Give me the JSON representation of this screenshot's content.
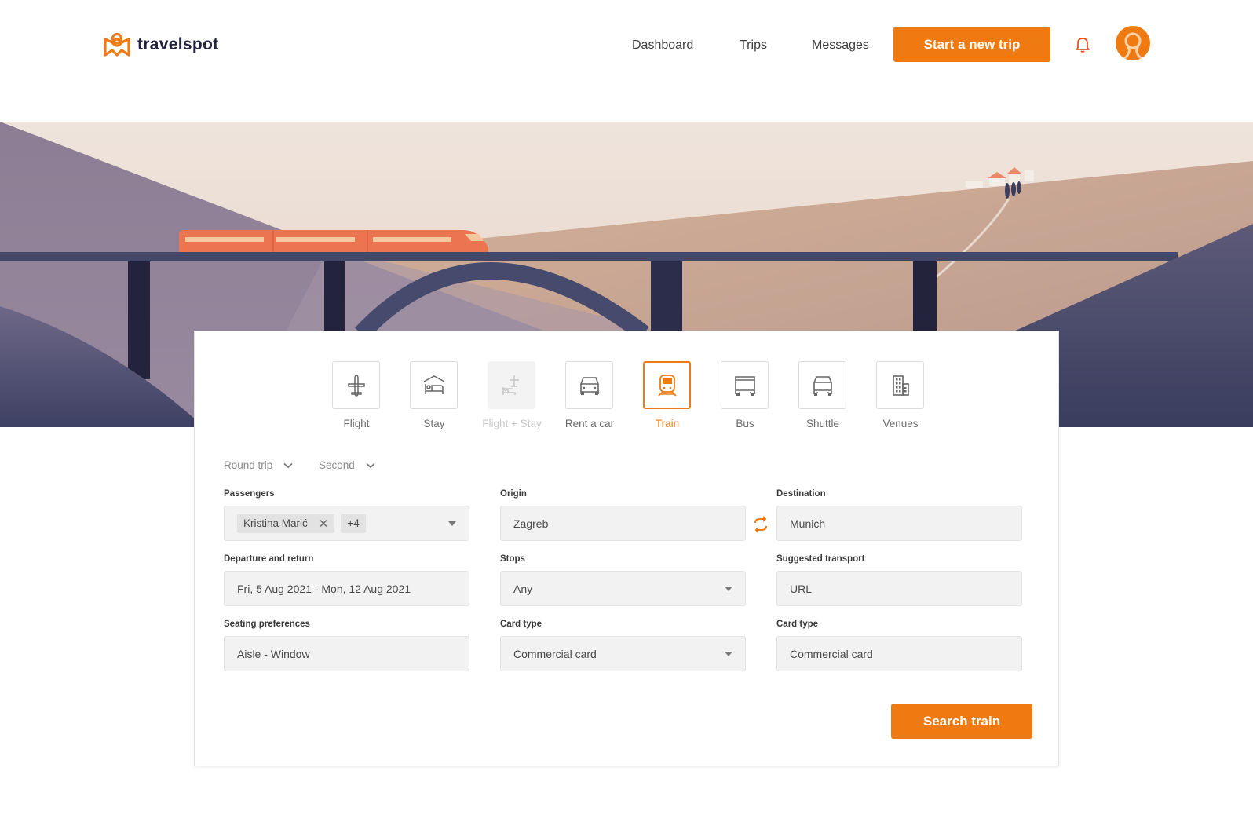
{
  "brand": {
    "name": "travelspot",
    "accent": "#f07a12",
    "text_color": "#23233d"
  },
  "nav": {
    "items": [
      {
        "label": "Dashboard"
      },
      {
        "label": "Trips"
      },
      {
        "label": "Messages"
      }
    ],
    "cta_label": "Start a new trip",
    "bell_icon": "bell-icon",
    "avatar_icon": "user-avatar"
  },
  "hero": {
    "illustration": "train-on-bridge-landscape"
  },
  "modes": {
    "selected": "Train",
    "items": [
      {
        "label": "Flight",
        "icon": "airplane-icon",
        "state": "default"
      },
      {
        "label": "Stay",
        "icon": "bed-icon",
        "state": "default"
      },
      {
        "label": "Flight + Stay",
        "icon": "flight-stay-icon",
        "state": "disabled"
      },
      {
        "label": "Rent a car",
        "icon": "car-icon",
        "state": "default"
      },
      {
        "label": "Train",
        "icon": "train-icon",
        "state": "active"
      },
      {
        "label": "Bus",
        "icon": "bus-icon",
        "state": "default"
      },
      {
        "label": "Shuttle",
        "icon": "shuttle-icon",
        "state": "default"
      },
      {
        "label": "Venues",
        "icon": "building-icon",
        "state": "default"
      }
    ]
  },
  "options": {
    "trip_type": "Round trip",
    "class": "Second"
  },
  "form": {
    "passengers": {
      "label": "Passengers",
      "chip": "Kristina Marić",
      "more": "+4"
    },
    "origin": {
      "label": "Origin",
      "value": "Zagreb"
    },
    "destination": {
      "label": "Destination",
      "value": "Munich"
    },
    "dates": {
      "label": "Departure and return",
      "value": "Fri, 5 Aug 2021 - Mon, 12 Aug 2021"
    },
    "stops": {
      "label": "Stops",
      "value": "Any"
    },
    "suggested_transport": {
      "label": "Suggested transport",
      "value": "URL"
    },
    "seating": {
      "label": "Seating preferences",
      "value": "Aisle - Window"
    },
    "card_type_1": {
      "label": "Card type",
      "value": "Commercial card"
    },
    "card_type_2": {
      "label": "Card type",
      "value": "Commercial card"
    }
  },
  "search_label": "Search train"
}
